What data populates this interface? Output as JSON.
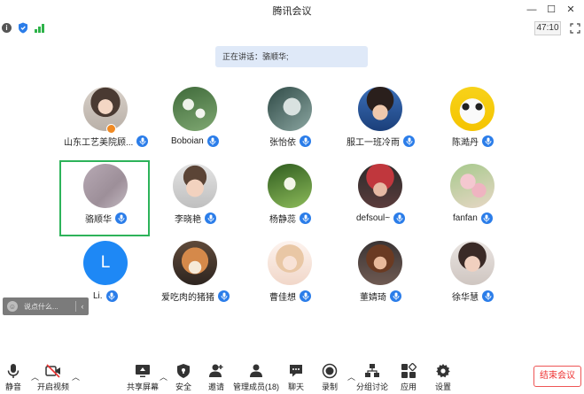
{
  "window": {
    "title": "腾讯会议",
    "controls": [
      {
        "name": "minimize-button",
        "glyph": "—"
      },
      {
        "name": "maximize-button",
        "glyph": "☐"
      },
      {
        "name": "close-button",
        "glyph": "✕"
      }
    ]
  },
  "status": {
    "timer": "47:10",
    "accent": "#2b7de9",
    "signal_color": "#2fb34a"
  },
  "speaker_banner": "正在讲话：骆顺华;",
  "participants": [
    {
      "name": "山东工艺美院顾...",
      "avatar": "photo-girl-headphones",
      "host": true
    },
    {
      "name": "Boboian",
      "avatar": "photo-white-flowers"
    },
    {
      "name": "张怡依",
      "avatar": "photo-silver-plant"
    },
    {
      "name": "服工一班冷雨",
      "avatar": "photo-young-man"
    },
    {
      "name": "陈澔丹",
      "avatar": "photo-panda-yellow"
    },
    {
      "name": "骆顺华",
      "avatar": "photo-blurred-pink",
      "active": true
    },
    {
      "name": "李晓艳",
      "avatar": "photo-child"
    },
    {
      "name": "杨静蕊",
      "avatar": "photo-green-leaf"
    },
    {
      "name": "defsoul~",
      "avatar": "photo-woman-hat"
    },
    {
      "name": "fanfan",
      "avatar": "photo-pink-blossom"
    },
    {
      "name": "Li.",
      "avatar": "letter",
      "letter": "L"
    },
    {
      "name": "爱吃肉的猪猪",
      "avatar": "photo-shiba-dog"
    },
    {
      "name": "曹佳想",
      "avatar": "photo-anime-girl"
    },
    {
      "name": "董婧琦",
      "avatar": "photo-woman-dark"
    },
    {
      "name": "徐华慧",
      "avatar": "photo-woman-hand"
    }
  ],
  "chat": {
    "placeholder": "说点什么...",
    "caret": "‹"
  },
  "toolbar": {
    "mute": "静音",
    "video": "开启视频",
    "share": "共享屏幕",
    "security": "安全",
    "invite": "邀请",
    "members": "管理成员(18)",
    "chat": "聊天",
    "record": "录制",
    "breakout": "分组讨论",
    "apps": "应用",
    "settings": "设置",
    "end": "结束会议"
  }
}
